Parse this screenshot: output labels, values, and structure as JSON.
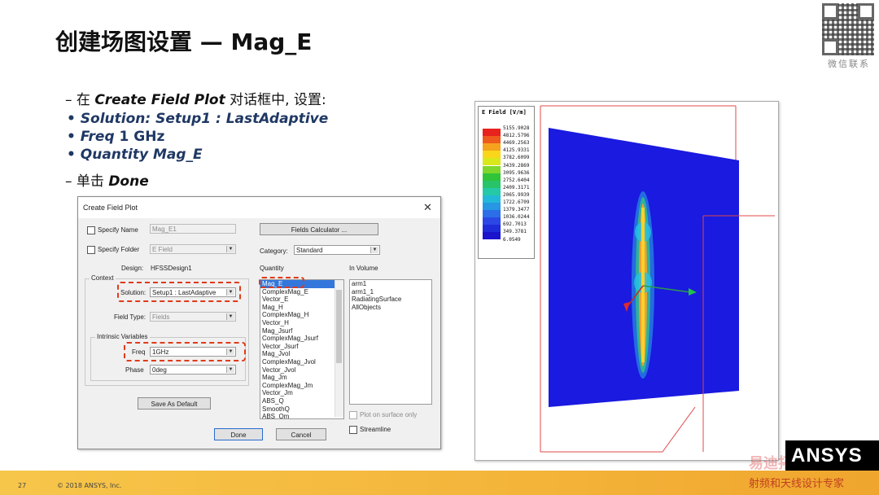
{
  "slide": {
    "title": "创建场图设置 — Mag_E",
    "qr_caption": "微信联系"
  },
  "bullets": {
    "line1_prefix": "– 在 ",
    "line1_em": "Create Field Plot",
    "line1_suffix": " 对话框中, 设置:",
    "solution": "• Solution: Setup1 : LastAdaptive",
    "freq_label": "• Freq",
    "freq_value": " 1 GHz",
    "quantity": "• Quantity Mag_E",
    "done_prefix": "– 单击 ",
    "done_em": "Done"
  },
  "dialog": {
    "title": "Create Field Plot",
    "close_glyph": "✕",
    "specify_name_label": "Specify Name",
    "specify_name_value": "Mag_E1",
    "specify_folder_label": "Specify Folder",
    "specify_folder_value": "E Field",
    "fields_calculator_label": "Fields Calculator ...",
    "category_label": "Category:",
    "category_value": "Standard",
    "design_label": "Design:",
    "design_value": "HFSSDesign1",
    "context_label": "Context",
    "solution_label": "Solution:",
    "solution_value": "Setup1 : LastAdaptive",
    "field_type_label": "Field Type:",
    "field_type_value": "Fields",
    "intrinsic_label": "Intrinsic Variables",
    "freq_label": "Freq",
    "freq_value": "1GHz",
    "phase_label": "Phase",
    "phase_value": "0deg",
    "save_default_label": "Save As Default",
    "quantity_header": "Quantity",
    "quantities": [
      "Mag_E",
      "ComplexMag_E",
      "Vector_E",
      "Mag_H",
      "ComplexMag_H",
      "Vector_H",
      "Mag_Jsurf",
      "ComplexMag_Jsurf",
      "Vector_Jsurf",
      "Mag_Jvol",
      "ComplexMag_Jvol",
      "Vector_Jvol",
      "Mag_Jm",
      "ComplexMag_Jm",
      "Vector_Jm",
      "ABS_Q",
      "SmoothQ",
      "ABS_Qm"
    ],
    "selected_quantity": "Mag_E",
    "in_volume_header": "In Volume",
    "volumes": [
      "arm1",
      "arm1_1",
      "RadiatingSurface",
      "AllObjects"
    ],
    "plot_on_surface_label": "Plot on surface only",
    "streamline_label": "Streamline",
    "done_label": "Done",
    "cancel_label": "Cancel"
  },
  "legend": {
    "title": "E Field [V/m]",
    "values": [
      "5155.9028",
      "4812.5796",
      "4469.2563",
      "4125.9331",
      "3782.6099",
      "3439.2869",
      "3095.9636",
      "2752.6404",
      "2409.3171",
      "2065.9939",
      "1722.6709",
      "1379.3477",
      "1036.0244",
      "692.7013",
      "349.3781",
      "6.0549"
    ],
    "colors": [
      "#e8221c",
      "#ef5a1d",
      "#f5a21e",
      "#f9d61a",
      "#d8e81a",
      "#7fd62c",
      "#2fc43a",
      "#27c46a",
      "#25c9a7",
      "#23b8d8",
      "#2796e3",
      "#2b6ee8",
      "#2b48e6",
      "#1f2cd9",
      "#1a14cc"
    ]
  },
  "footer": {
    "page_number": "27",
    "copyright": "© 2018 ANSYS, Inc.",
    "logo": "ANSYS",
    "watermark": "射频和天线设计专家",
    "watermark_top": "易迪拓培训"
  }
}
